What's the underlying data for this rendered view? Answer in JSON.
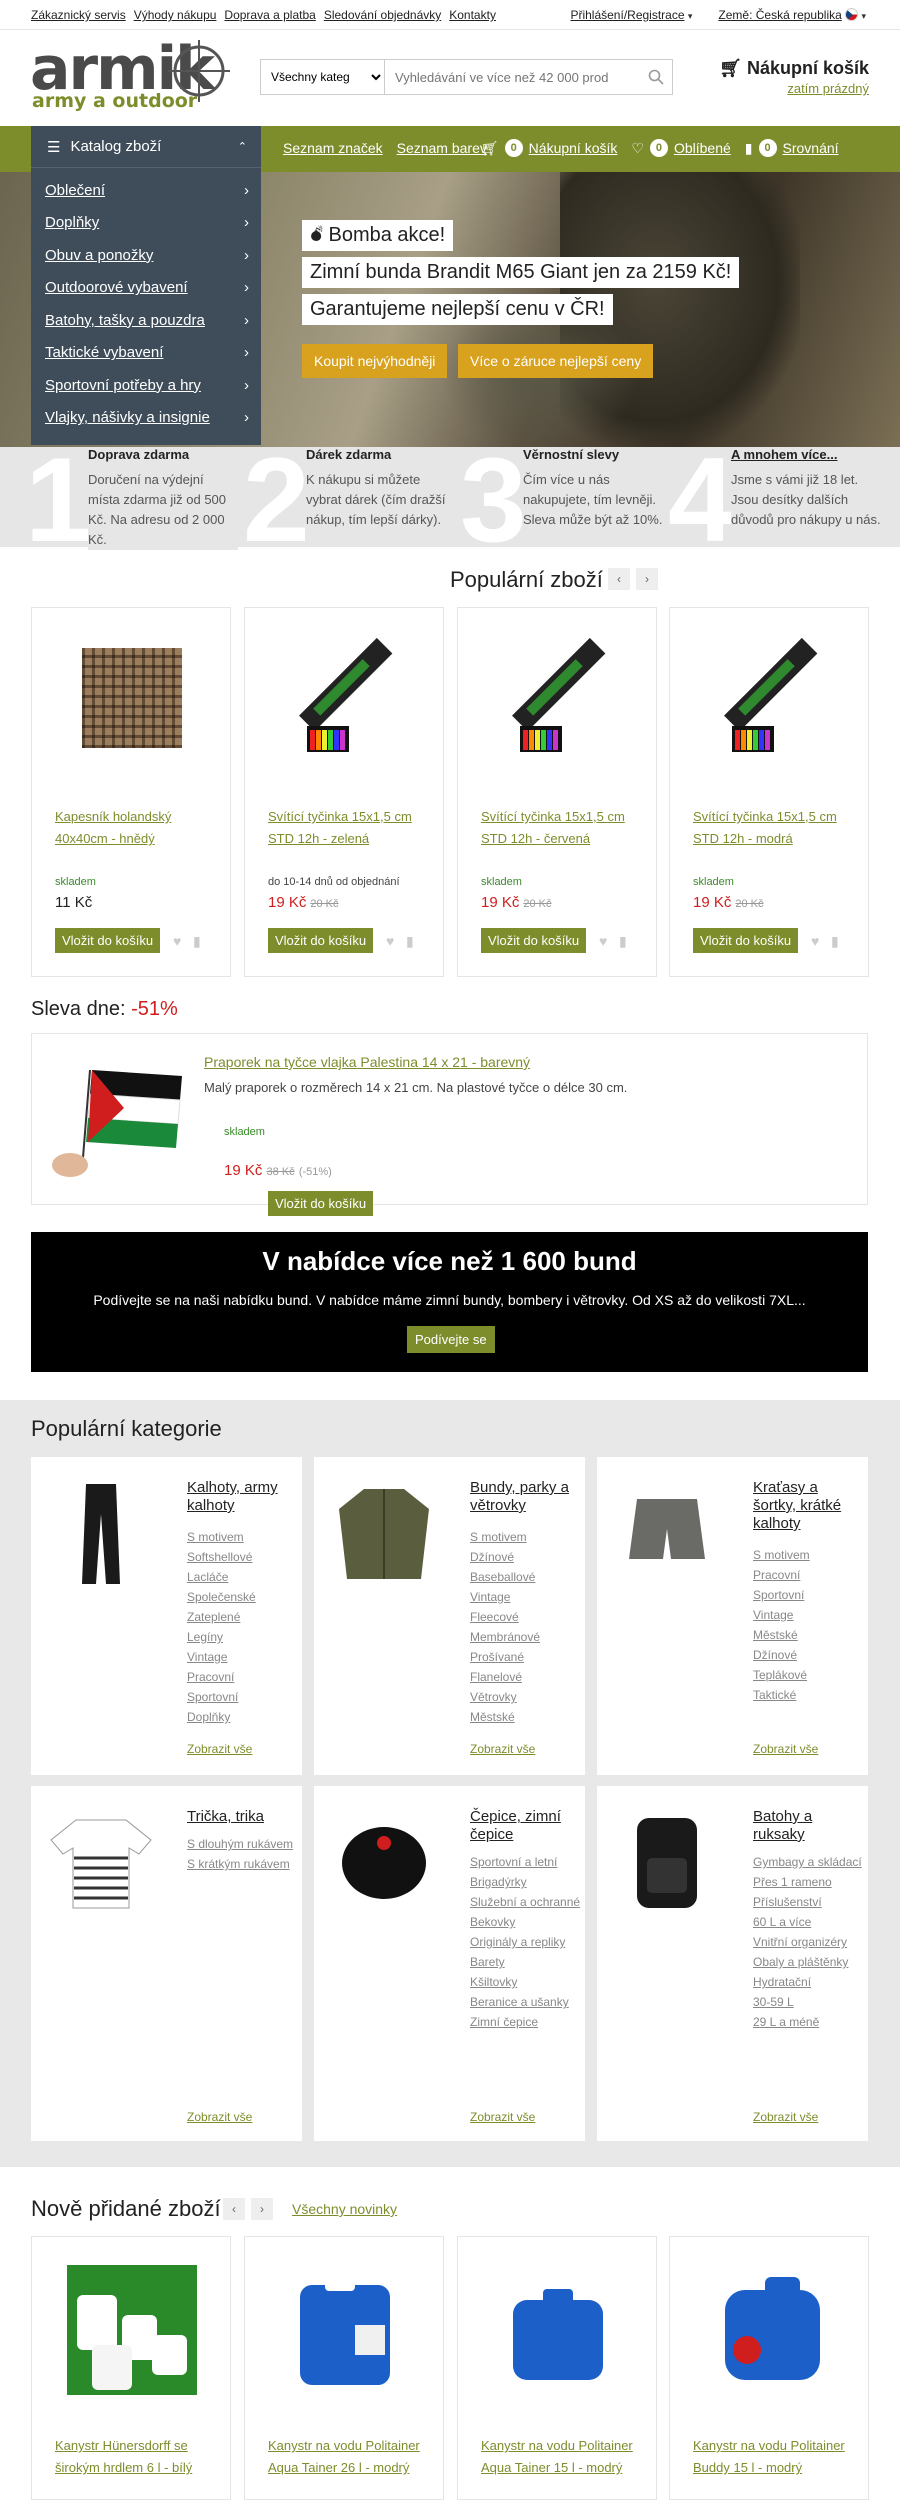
{
  "topbar": {
    "links": [
      "Zákaznický servis",
      "Výhody nákupu",
      "Doprava a platba",
      "Sledování objednávky",
      "Kontakty"
    ],
    "login": "Přihlášení/Registrace",
    "country": "Země: Česká republika"
  },
  "header": {
    "logo_name": "armik",
    "logo_sub": "army a outdoor",
    "search_category": "Všechny kateg",
    "search_placeholder": "Vyhledávání ve více než 42 000 prod",
    "cart_title": "Nákupní košík",
    "cart_status": "zatím prázdný"
  },
  "nav": {
    "catalog_label": "Katalog zboží",
    "links": {
      "brands": "Seznam značek",
      "colors": "Seznam barev",
      "cart": "Nákupní košík",
      "cart_count": "0",
      "fav": "Oblíbené",
      "fav_count": "0",
      "compare": "Srovnání",
      "compare_count": "0"
    }
  },
  "catalog": {
    "items": [
      "Oblečení",
      "Doplňky",
      "Obuv a ponožky",
      "Outdoorové vybavení",
      "Batohy, tašky a pouzdra",
      "Taktické vybavení",
      "Sportovní potřeby a hry",
      "Vlajky, nášivky a insignie"
    ]
  },
  "hero": {
    "line1": "Bomba akce!",
    "line2": "Zimní bunda Brandit M65 Giant jen za 2159 Kč!",
    "line3": "Garantujeme nejlepší cenu v ČR!",
    "btn1": "Koupit nejvýhodněji",
    "btn2": "Více o záruce nejlepší ceny"
  },
  "steps": [
    {
      "num": "1",
      "title": "Doprava zdarma",
      "text": "Doručení na výdejní místa zdarma již od 500 Kč. Na adresu od 2 000 Kč."
    },
    {
      "num": "2",
      "title": "Dárek zdarma",
      "text": "K nákupu si můžete vybrat dárek (čím dražší nákup, tím lepší dárky)."
    },
    {
      "num": "3",
      "title": "Věrnostní slevy",
      "text": "Čím více u nás nakupujete, tím levněji. Sleva může být až 10%."
    },
    {
      "num": "4",
      "title": "A mnohem více...",
      "text": "Jsme s vámi již 18 let. Jsou desítky dalších důvodů pro nákupy u nás."
    }
  ],
  "popular": {
    "title": "Populární zboží",
    "products": [
      {
        "name": "Kapesník holandský 40x40cm - hnědý",
        "stock": "skladem",
        "price": "11 Kč",
        "old": "",
        "buy": "Vložit do košíku"
      },
      {
        "name": "Svítící tyčinka 15x1,5 cm STD 12h - zelená",
        "stock": "do 10-14 dnů od objednání",
        "price": "19 Kč",
        "old": "20 Kč",
        "buy": "Vložit do košíku"
      },
      {
        "name": "Svítící tyčinka 15x1,5 cm STD 12h - červená",
        "stock": "skladem",
        "price": "19 Kč",
        "old": "20 Kč",
        "buy": "Vložit do košíku"
      },
      {
        "name": "Svítící tyčinka 15x1,5 cm STD 12h - modrá",
        "stock": "skladem",
        "price": "19 Kč",
        "old": "20 Kč",
        "buy": "Vložit do košíku"
      }
    ]
  },
  "deal": {
    "label": "Sleva dne:",
    "pct": "-51%",
    "name": "Praporek na tyčce vlajka Palestina 14 x 21 - barevný",
    "desc": "Malý praporek o rozměrech 14 x 21 cm. Na plastové tyčce o délce 30 cm.",
    "stock": "skladem",
    "price": "19 Kč",
    "old": "38 Kč",
    "save": "(-51%)",
    "buy": "Vložit do košíku"
  },
  "promo": {
    "title": "V nabídce více než 1 600 bund",
    "text": "Podívejte se na naši nabídku bund. V nabídce máme zimní bundy, bombery i větrovky. Od XS až do velikosti 7XL...",
    "button": "Podívejte se"
  },
  "categories": {
    "title": "Populární kategorie",
    "show_all": "Zobrazit vše",
    "items": [
      {
        "title": "Kalhoty, army kalhoty",
        "links": [
          "S motivem",
          "Softshellové",
          "Lacláče",
          "Společenské",
          "Zateplené",
          "Legíny",
          "Vintage",
          "Pracovní",
          "Sportovní",
          "Doplňky"
        ]
      },
      {
        "title": "Bundy, parky a větrovky",
        "links": [
          "S motivem",
          "Džínové",
          "Baseballové",
          "Vintage",
          "Fleecové",
          "Membránové",
          "Prošívané",
          "Flanelové",
          "Větrovky",
          "Městské"
        ]
      },
      {
        "title": "Kraťasy a šortky, krátké kalhoty",
        "links": [
          "S motivem",
          "Pracovní",
          "Sportovní",
          "Vintage",
          "Městské",
          "Džínové",
          "Teplákové",
          "Taktické"
        ]
      },
      {
        "title": "Trička, trika",
        "links": [
          "S dlouhým rukávem",
          "S krátkým rukávem"
        ]
      },
      {
        "title": "Čepice, zimní čepice",
        "links": [
          "Sportovní a letní",
          "Brigadýrky",
          "Služební a ochranné",
          "Bekovky",
          "Originály a repliky",
          "Barety",
          "Kšiltovky",
          "Beranice a ušanky",
          "Zimní čepice"
        ]
      },
      {
        "title": "Batohy a ruksaky",
        "links": [
          "Gymbagy a skládací",
          "Přes 1 rameno",
          "Příslušenství",
          "60 L a více",
          "Vnitřní organizéry",
          "Obaly a pláštěnky",
          "Hydratační",
          "30-59 L",
          "29 L a méně"
        ]
      }
    ]
  },
  "newest": {
    "title": "Nově přidané zboží",
    "all": "Všechny novinky",
    "products": [
      {
        "name": "Kanystr Hünersdorff se širokým hrdlem 6 l - bílý"
      },
      {
        "name": "Kanystr na vodu Politainer Aqua Tainer 26 l - modrý"
      },
      {
        "name": "Kanystr na vodu Politainer Aqua Tainer 15 l - modrý"
      },
      {
        "name": "Kanystr na vodu Politainer Buddy 15 l - modrý"
      }
    ]
  }
}
